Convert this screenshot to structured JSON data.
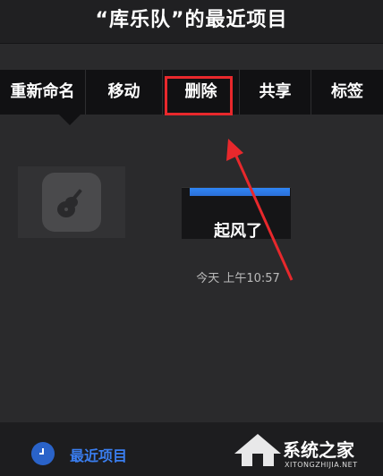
{
  "header": {
    "title": "“库乐队”的最近项目"
  },
  "menu": {
    "items": [
      {
        "label": "重新命名"
      },
      {
        "label": "移动"
      },
      {
        "label": "删除"
      },
      {
        "label": "共享"
      },
      {
        "label": "标签"
      }
    ]
  },
  "project": {
    "name": "起风了",
    "date": "今天 上午10:57"
  },
  "bottom_tab": {
    "label": "最近项目"
  },
  "watermark": {
    "text": "系统之家",
    "sub": "XITONGZHIJIA.NET"
  },
  "colors": {
    "highlight": "#e8282c",
    "accent": "#3a7ef0"
  },
  "icons": [
    "guitar-icon",
    "clock-icon",
    "arrow-icon",
    "house-logo-icon"
  ]
}
